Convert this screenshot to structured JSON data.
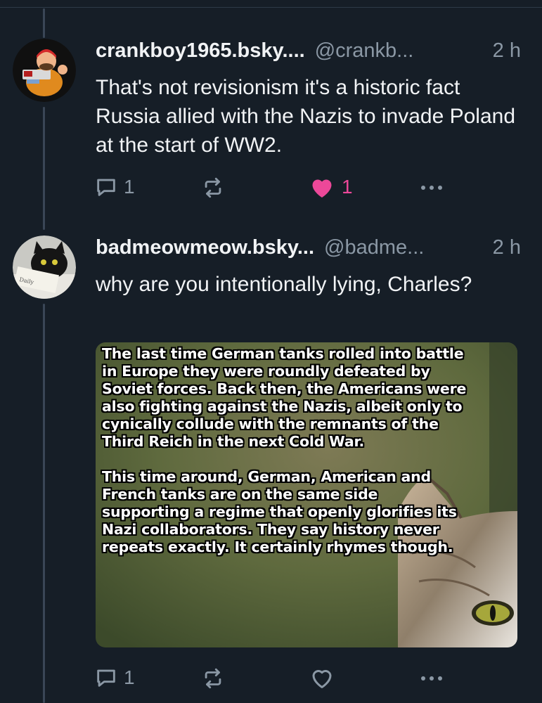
{
  "posts": [
    {
      "display_name": "crankboy1965.bsky....",
      "handle": "@crankb...",
      "time": "2 h",
      "text": "That's not revisionism it's a historic fact Russia allied with the Nazis to invade Poland at the start of WW2.",
      "reply_count": "1",
      "like_count": "1",
      "liked": true
    },
    {
      "display_name": "badmeowmeow.bsky...",
      "handle": "@badme...",
      "time": "2 h",
      "text": "why are you intentionally lying, Charles?",
      "reply_count": "1",
      "like_count": "",
      "liked": false,
      "image_text": {
        "para1": "The last time German tanks rolled into battle in Europe they were roundly defeated by Soviet forces. Back then, the Americans were also fighting against the Nazis, albeit only to cynically collude with the remnants of the Third Reich in the next Cold War.",
        "para2": "This time around, German, American and French tanks are on the same side supporting a regime that openly glorifies its Nazi collaborators. They say history never repeats exactly. It certainly rhymes though."
      }
    }
  ],
  "colors": {
    "background": "#161e27",
    "muted_text": "#8b98a5",
    "like_accent": "#ec4899"
  },
  "icons": [
    "reply-icon",
    "repost-icon",
    "heart-icon",
    "more-icon"
  ]
}
